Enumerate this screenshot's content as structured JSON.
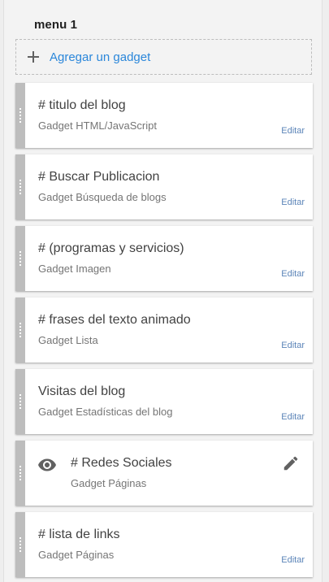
{
  "section": {
    "title": "menu 1",
    "add_label": "Agregar un gadget"
  },
  "colors": {
    "link": "#2b87da",
    "edit_link": "#5b84b8",
    "handle": "#bdbdbd"
  },
  "gadgets": [
    {
      "title": "# titulo del blog",
      "type": "Gadget HTML/JavaScript",
      "edit": "Editar"
    },
    {
      "title": "# Buscar Publicacion",
      "type": "Gadget Búsqueda de blogs",
      "edit": "Editar"
    },
    {
      "title": "# (programas y servicios)",
      "type": "Gadget Imagen",
      "edit": "Editar"
    },
    {
      "title": "# frases del texto animado",
      "type": "Gadget Lista",
      "edit": "Editar"
    },
    {
      "title": "Visitas del blog",
      "type": "Gadget Estadísticas del blog",
      "edit": "Editar"
    },
    {
      "title": "# Redes Sociales",
      "type": "Gadget Páginas",
      "icons": [
        "eye-icon",
        "pencil-icon"
      ]
    },
    {
      "title": "# lista de links",
      "type": "Gadget Páginas",
      "edit": "Editar"
    }
  ]
}
